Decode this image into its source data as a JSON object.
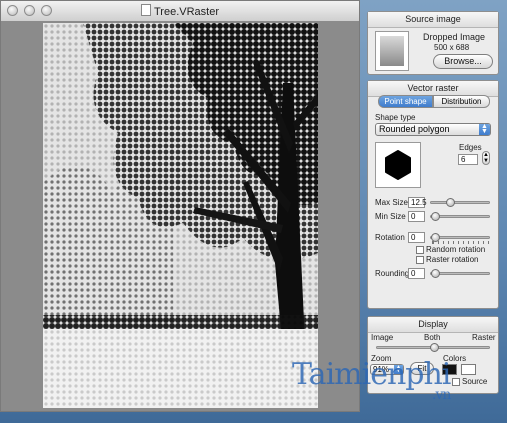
{
  "window": {
    "title": "Tree.VRaster"
  },
  "source_panel": {
    "title": "Source image",
    "name": "Dropped Image",
    "size": "500 x 688",
    "browse_label": "Browse..."
  },
  "raster_panel": {
    "title": "Vector raster",
    "tabs": [
      {
        "label": "Point shape",
        "selected": true
      },
      {
        "label": "Distribution",
        "selected": false
      }
    ],
    "shape_type_label": "Shape type",
    "shape_type_value": "Rounded polygon",
    "edges_label": "Edges",
    "edges_value": "6",
    "max_size_label": "Max Size",
    "max_size_value": "12.5",
    "max_size_level": 0.3,
    "min_size_label": "Min Size",
    "min_size_value": "0",
    "min_size_level": 0.0,
    "rotation_label": "Rotation",
    "rotation_value": "0",
    "rotation_level": 0.0,
    "random_rotation_label": "Random rotation",
    "raster_rotation_label": "Raster rotation",
    "rounding_label": "Rounding",
    "rounding_value": "0",
    "rounding_level": 0.0
  },
  "display_panel": {
    "title": "Display",
    "image_label": "Image",
    "both_label": "Both",
    "raster_label": "Raster",
    "mode_level": 0.5,
    "zoom_label": "Zoom",
    "zoom_value": "91%",
    "fit_label": "Fit",
    "colors_label": "Colors",
    "source_label": "Source",
    "colors": {
      "foreground": "#111111",
      "background": "#ffffff"
    }
  },
  "watermark": {
    "text": "Taimienphi",
    "suffix": ".vn"
  }
}
